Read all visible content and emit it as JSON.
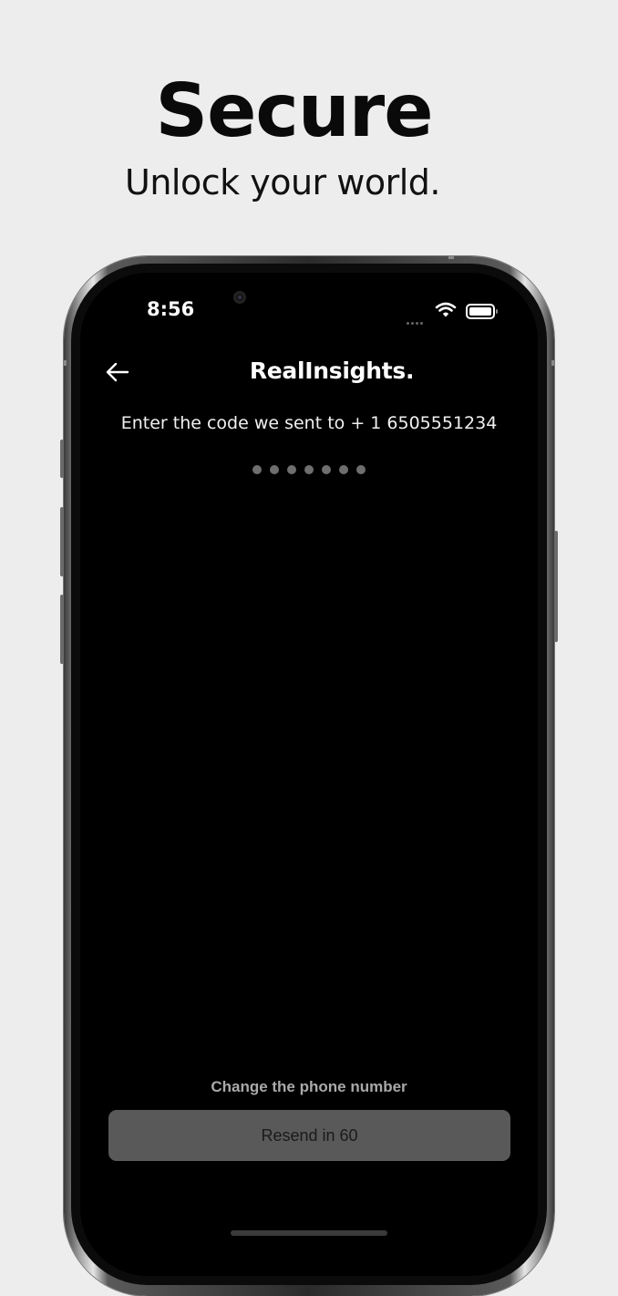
{
  "promo": {
    "headline": "Secure",
    "subheadline": "Unlock your world."
  },
  "status_bar": {
    "time": "8:56",
    "icons": [
      "signal-dots-icon",
      "wifi-icon",
      "battery-icon"
    ]
  },
  "header": {
    "back_icon": "arrow-left-icon",
    "title": "RealInsights."
  },
  "verification": {
    "prompt": "Enter the code we sent to + 1 6505551234",
    "code_length": 7,
    "code_value": ""
  },
  "footer": {
    "change_number_label": "Change the phone number",
    "resend_label": "Resend in 60",
    "resend_enabled": false
  },
  "colors": {
    "page_background": "#ededed",
    "screen_background": "#000000",
    "placeholder_dot": "#6e6e6e",
    "disabled_button": "#595959"
  }
}
